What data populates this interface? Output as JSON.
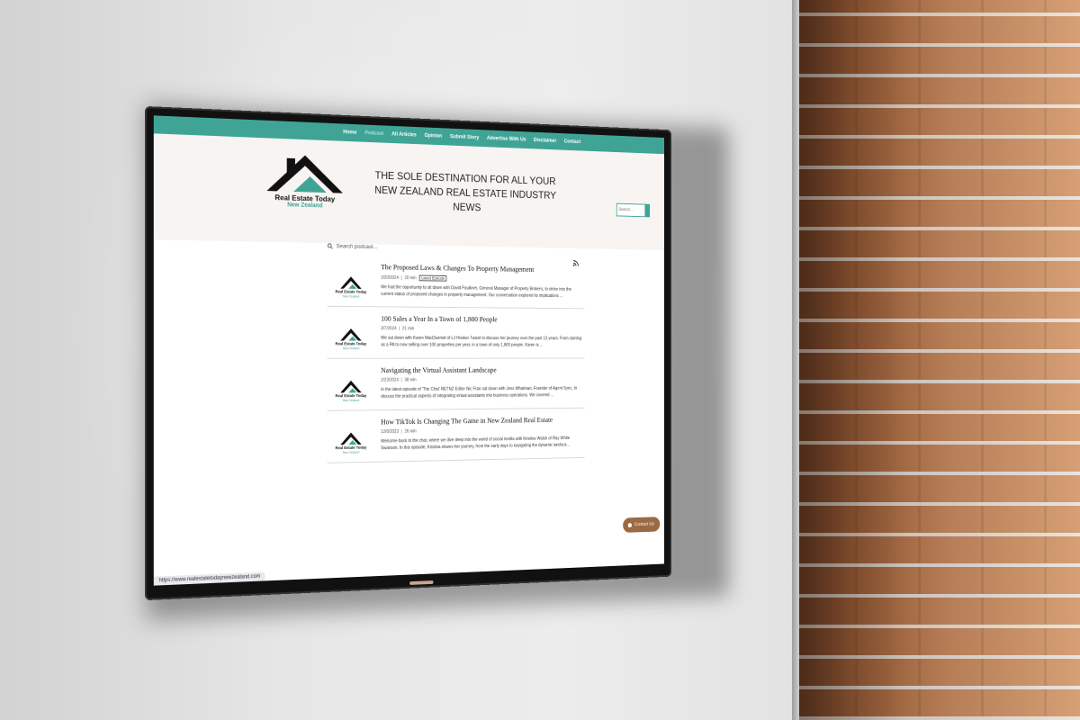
{
  "nav": {
    "items": [
      {
        "label": "Home",
        "active": false
      },
      {
        "label": "Podcast",
        "active": true
      },
      {
        "label": "All Articles",
        "active": false
      },
      {
        "label": "Opinion",
        "active": false
      },
      {
        "label": "Submit Story",
        "active": false
      },
      {
        "label": "Advertise With Us",
        "active": false
      },
      {
        "label": "Disclaimer",
        "active": false
      },
      {
        "label": "Contact",
        "active": false
      }
    ]
  },
  "header": {
    "logo_title": "Real Estate Today",
    "logo_subtitle": "New Zealand",
    "tagline": "THE SOLE DESTINATION FOR ALL YOUR NEW ZEALAND REAL ESTATE INDUSTRY NEWS",
    "search_placeholder": "Search..."
  },
  "podcast": {
    "search_placeholder": "Search podcast...",
    "episodes": [
      {
        "title": "The Proposed Laws & Changes To Property Management",
        "date": "3/20/2024",
        "duration": "20 min",
        "badge": "Latest Episode",
        "description": "We had the opportunity to sit down with David Faulkner, General Manager of Property Brokers, to delve into the current status of proposed changes in property management. Our conversation explored its implications ..."
      },
      {
        "title": "100 Sales a Year In a Town of 1,800 People",
        "date": "3/7/2024",
        "duration": "21 min",
        "badge": "",
        "description": "We sat down with Karen MacDiarmid of LJ Hooker Twizel to discuss her journey over the past 13 years. From starting as a PA to now selling over 100 properties per year, in a town of only 1,800 people. Karen is ..."
      },
      {
        "title": "Navigating the Virtual Assistant Landscape",
        "date": "2/23/2024",
        "duration": "38 min",
        "badge": "",
        "description": "In the latest episode of 'The Chat' RETNZ Editor Nic Fran sat down with Jess Whatman, Founder of Agent Sync, to discuss the practical aspects of integrating virtual assistants into business operations. We covered ..."
      },
      {
        "title": "How TikTok Is Changing The Game in New Zealand Real Estate",
        "date": "12/6/2023",
        "duration": "26 min",
        "badge": "",
        "description": "Welcome back to the chat, where we dive deep into the world of social media with Kristina Walsh of Ray White Swanson. In this episode, Kristina shares her journey, from the early days to navigating the dynamic landsca..."
      }
    ],
    "thumb_title": "Real Estate Today",
    "thumb_subtitle": "New Zealand"
  },
  "contact_button": "Contact Us",
  "status_url": "https://www.realestatetodaynewzealand.com",
  "colors": {
    "brand_teal": "#3fa496",
    "contact_brown": "#9a6a44"
  }
}
